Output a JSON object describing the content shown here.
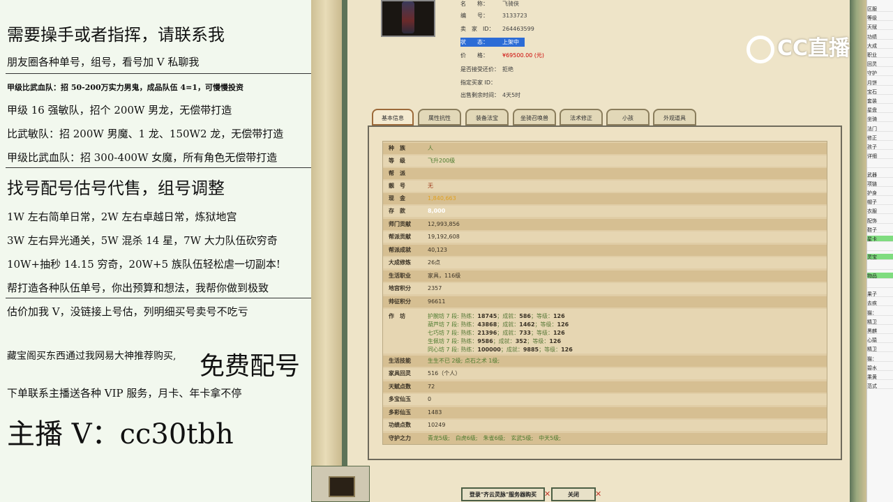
{
  "left_panel": {
    "line1": "需要操手或者指挥，请联系我",
    "line2": "朋友圈各种单号，组号，看号加 V 私聊我",
    "line3": "甲级比武血队：招 50-200万实力男鬼，成品队伍 4=1，可慢慢投资",
    "line4": "甲级 16 强敏队，招个 200W 男龙，无偿带打造",
    "line5": "比武敏队：招 200W 男魔、1 龙、150W2 龙，无偿带打造",
    "line6": "甲级比武血队：招 300-400W 女魔，所有角色无偿带打造",
    "line7": "找号配号估号代售，组号调整",
    "line8": "1W 左右简单日常，2W 左右卓越日常，炼狱地宫",
    "line9": "3W 左右异光通关，5W 混杀 14 星，7W 大力队伍砍穷奇",
    "line10": "10W+抽秒 14.15 穷奇，20W+5 族队伍轻松虐一切副本!",
    "line11": "帮打造各种队伍单号，你出预算和想法，我帮你做到极致",
    "line12": "估价加我 V，没链接上号估，列明细买号卖号不吃亏",
    "line13a": "藏宝阁买东西通过我网易大神推荐购买,",
    "line13b": "免费配号",
    "line14": "下单联系主播送各种 VIP 服务，月卡、年卡拿不停",
    "line15": "主播 V：cc30tbh"
  },
  "watermark": "CC直播",
  "char_info": {
    "name_label": "名　　称：",
    "name": "飞骑侠",
    "id_label": "编　　号：",
    "id": "3133723",
    "seller_label": "卖　家　ID：",
    "seller_id": "264463599",
    "status_label": "状　　态：",
    "status": "上架中",
    "price_label": "价　　格：",
    "price": "¥69500.00 (元)",
    "counter_label": "是否接受还价：",
    "counter": "拒绝",
    "buyer_label": "指定买家 ID：",
    "buyer": "",
    "time_label": "出售剩余时间：",
    "time": "4天5时"
  },
  "tabs": [
    "基本信息",
    "属性抗性",
    "装备法宝",
    "坐骑召唤兽",
    "法术修正",
    "小孩",
    "外观道具"
  ],
  "rows": [
    {
      "k": "种　族",
      "v": "人"
    },
    {
      "k": "等　级",
      "v": "飞升200级"
    },
    {
      "k": "帮　派",
      "v": ""
    },
    {
      "k": "靓　号",
      "v": "无"
    },
    {
      "k": "现　金",
      "v": "1,840,663"
    },
    {
      "k": "存　款",
      "v": "8,000"
    },
    {
      "k": "师门贡献",
      "v": "12,993,856"
    },
    {
      "k": "帮派贡献",
      "v": "19,192,608"
    },
    {
      "k": "帮派成就",
      "v": "40,123"
    },
    {
      "k": "大成修炼",
      "v": "26点"
    },
    {
      "k": "生活职业",
      "v": "家具，116级"
    },
    {
      "k": "地宫积分",
      "v": "2357"
    },
    {
      "k": "帅征积分",
      "v": "96611"
    },
    {
      "k": "作　坊",
      "v": ""
    }
  ],
  "workshop": [
    {
      "name": "护腕坊 7 段:",
      "sk": "熟练：",
      "a": "18745",
      "cl": "；成就：",
      "b": "586",
      "lvl": "；等级：",
      "c": "126"
    },
    {
      "name": "葫芦坊 7 段:",
      "sk": "熟练：",
      "a": "43868",
      "cl": "；成就：",
      "b": "1462",
      "lvl": "；等级：",
      "c": "126"
    },
    {
      "name": "七巧坊 7 段:",
      "sk": "熟练：",
      "a": "21396",
      "cl": "；成就：",
      "b": "733",
      "lvl": "；等级：",
      "c": "126"
    },
    {
      "name": "生佩坊 7 段:",
      "sk": "熟练：",
      "a": "9586",
      "cl": "；成就：",
      "b": "352",
      "lvl": "；等级：",
      "c": "126"
    },
    {
      "name": "同心坊 7 段:",
      "sk": "熟练：",
      "a": "100000",
      "cl": "；成就：",
      "b": "9885",
      "lvl": "；等级：",
      "c": "126"
    }
  ],
  "rows2": [
    {
      "k": "生活技能",
      "v": "生生不已 2级; 点石之术 1级;"
    },
    {
      "k": "家具回灵",
      "v": "516（个人）"
    },
    {
      "k": "天赋点数",
      "v": "72"
    },
    {
      "k": "多宝仙玉",
      "v": "0"
    },
    {
      "k": "多彩仙玉",
      "v": "1483"
    },
    {
      "k": "功绩点数",
      "v": "10249"
    },
    {
      "k": "守护之力",
      "v": "青龙5级;　白虎6级;　朱雀6级;　玄武5级;　中天5级;"
    }
  ],
  "buttons": {
    "login": "登录\"齐云灵脉\"服务器购买",
    "close": "关闭"
  },
  "chat_lines": [
    "区服",
    "等级",
    "天赋",
    "功绩",
    "大成",
    "职业",
    "回灵",
    "守护",
    "月饼",
    "宝石",
    "套装",
    "星盘",
    "坐骑",
    "法门",
    "修正",
    "孩子",
    "详细",
    "",
    "武器",
    "项链",
    "护身",
    "帽子",
    "衣服",
    "配饰",
    "鞋子",
    "星卡",
    "",
    "灵宝",
    "",
    "物品",
    "",
    "果子",
    "去疾",
    "猫：",
    "精卫",
    "黑麒",
    "心猿",
    "精卫",
    "猫：",
    "碧水",
    "乘黄",
    "范式"
  ]
}
